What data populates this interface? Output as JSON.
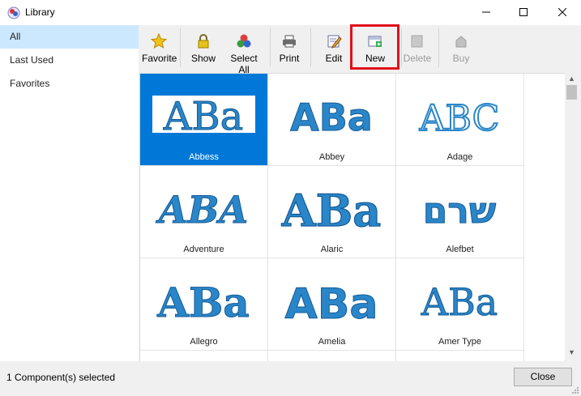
{
  "window": {
    "title": "Library",
    "minimize_icon": "minimize-icon",
    "maximize_icon": "maximize-icon",
    "close_icon": "close-icon"
  },
  "sidebar": {
    "items": [
      {
        "label": "All",
        "selected": true
      },
      {
        "label": "Last Used",
        "selected": false
      },
      {
        "label": "Favorites",
        "selected": false
      }
    ]
  },
  "toolbar": {
    "buttons": [
      {
        "label": "Favorite",
        "icon": "star-icon",
        "enabled": true
      },
      {
        "label": "Show",
        "icon": "lock-icon",
        "enabled": true
      },
      {
        "label": "Select All",
        "icon": "select-all-icon",
        "enabled": true
      },
      {
        "label": "Print",
        "icon": "printer-icon",
        "enabled": true
      },
      {
        "label": "Edit",
        "icon": "edit-icon",
        "enabled": true
      },
      {
        "label": "New",
        "icon": "new-icon",
        "enabled": true
      },
      {
        "label": "Delete",
        "icon": "delete-icon",
        "enabled": false
      },
      {
        "label": "Buy",
        "icon": "buy-icon",
        "enabled": false
      }
    ],
    "highlight_color": "#e1101a"
  },
  "fonts": {
    "items": [
      {
        "name": "Abbess",
        "sample": "ABa",
        "selected": true
      },
      {
        "name": "Abbey",
        "sample": "ABa",
        "selected": false
      },
      {
        "name": "Adage",
        "sample": "ABC",
        "selected": false
      },
      {
        "name": "Adventure",
        "sample": "ABA",
        "selected": false
      },
      {
        "name": "Alaric",
        "sample": "ABa",
        "selected": false
      },
      {
        "name": "Alefbet",
        "sample": "שרם",
        "selected": false
      },
      {
        "name": "Allegro",
        "sample": "ABa",
        "selected": false
      },
      {
        "name": "Amelia",
        "sample": "ABa",
        "selected": false
      },
      {
        "name": "Amer Type",
        "sample": "ABa",
        "selected": false
      }
    ],
    "accent": "#2a86c8",
    "selection_color": "#0078d7"
  },
  "status": {
    "text": "1 Component(s) selected",
    "close_label": "Close"
  }
}
